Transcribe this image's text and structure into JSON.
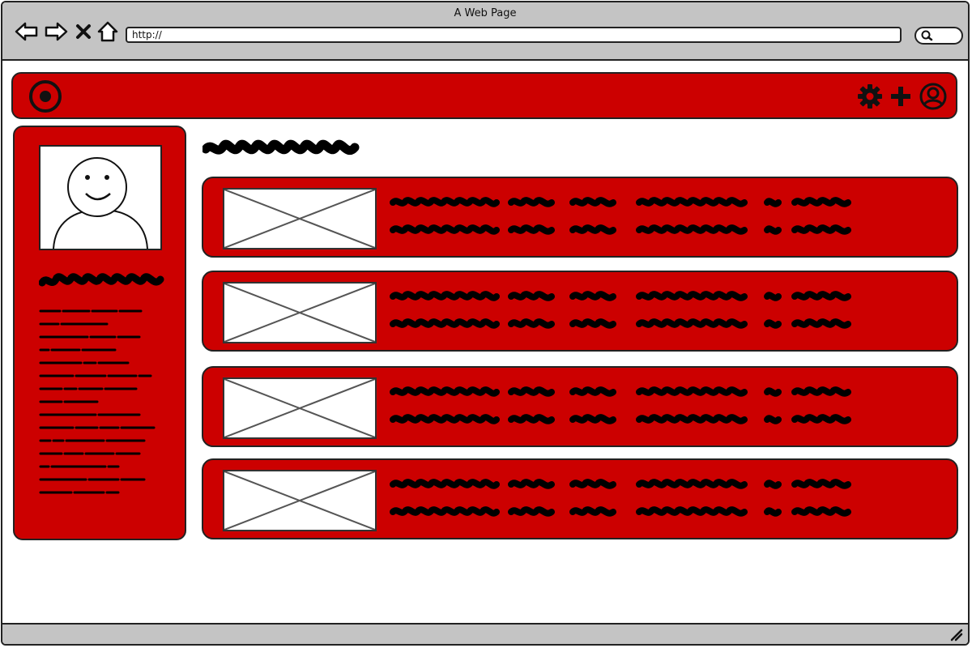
{
  "browser": {
    "title": "A Web Page",
    "url": "http://",
    "nav_icons": [
      "back-arrow-icon",
      "forward-arrow-icon",
      "stop-icon",
      "home-icon"
    ]
  },
  "header": {
    "logo_icon": "target-logo-icon",
    "right_icons": [
      "gear-icon",
      "plus-icon",
      "user-icon"
    ]
  },
  "sidebar": {
    "avatar_icon": "smiley-user-icon"
  },
  "cards_count": 4,
  "colors": {
    "accent": "#cc0000",
    "chrome": "#c4c4c4",
    "outline": "#222222"
  }
}
